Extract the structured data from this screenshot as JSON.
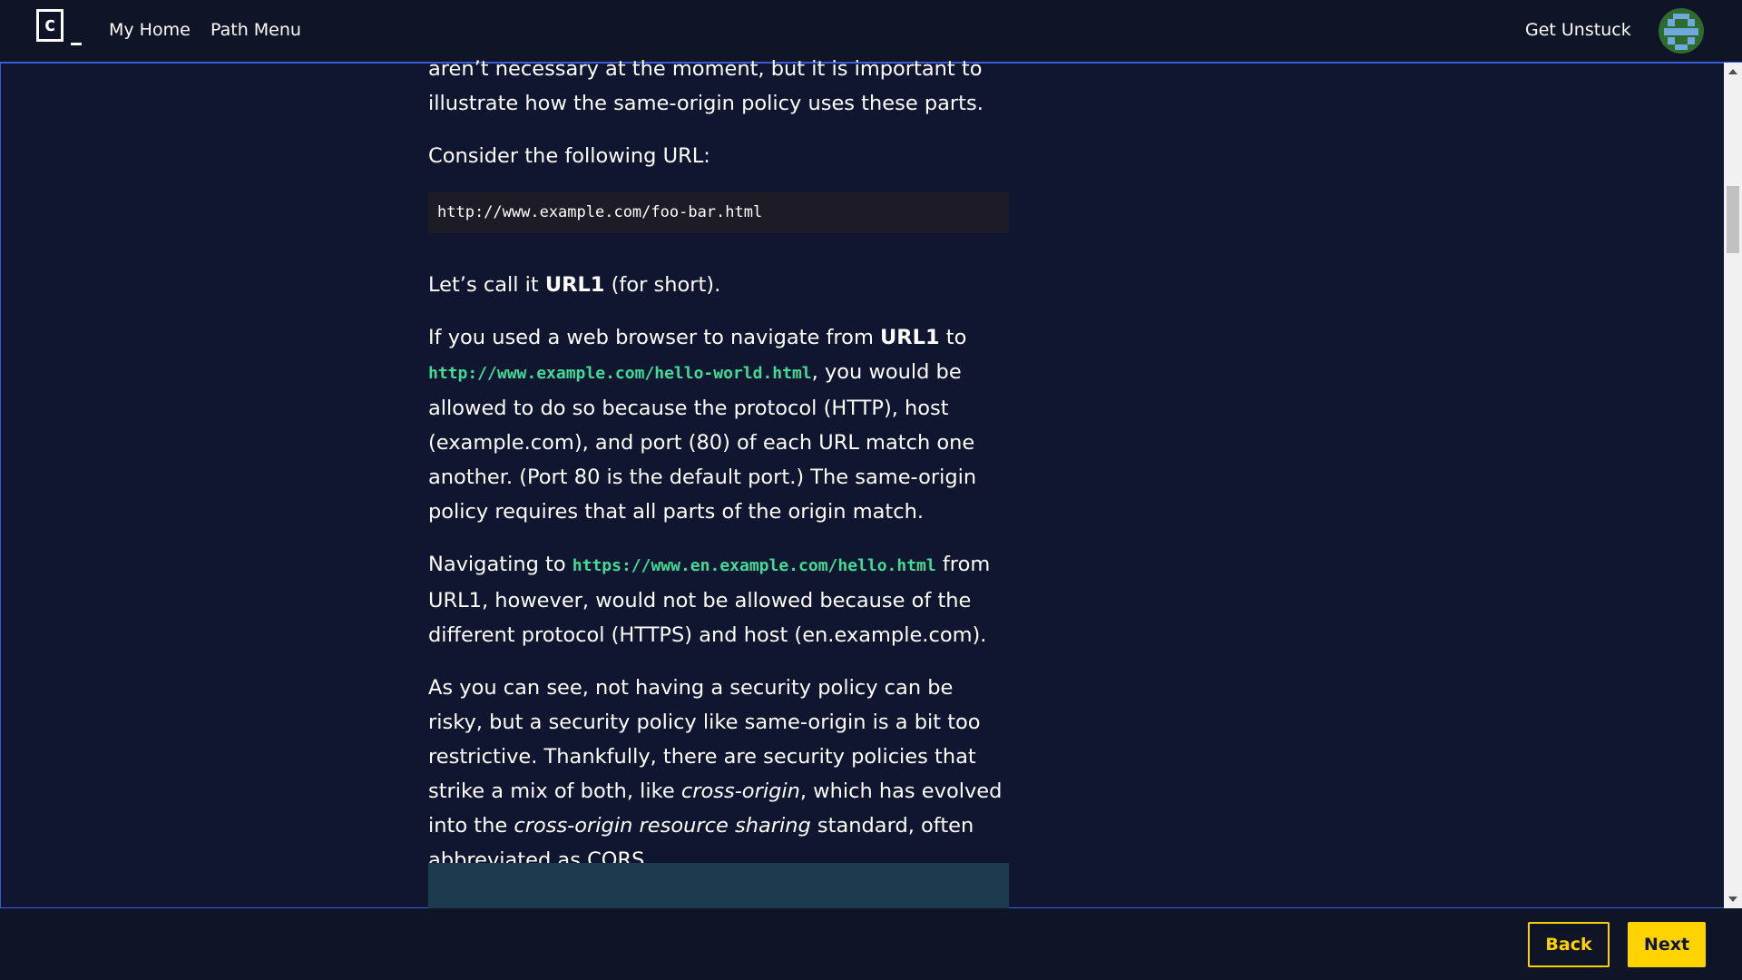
{
  "header": {
    "logo_text": "c",
    "nav": [
      "My Home",
      "Path Menu"
    ],
    "help_label": "Get Unstuck"
  },
  "article": {
    "p0": "aren’t necessary at the moment, but it is important to illustrate how the same-origin policy uses these parts.",
    "p1": "Consider the following URL:",
    "code1": "http://www.example.com/foo-bar.html",
    "p2_a": "Let’s call it ",
    "p2_b": "URL1",
    "p2_c": " (for short).",
    "p3_a": "If you used a web browser to navigate from ",
    "p3_b": "URL1",
    "p3_c": " to ",
    "p3_code": "http://www.example.com/hello-world.html",
    "p3_d": ", you would be allowed to do so because the protocol (HTTP), host (example.com), and port (80) of each URL match one another. (Port 80 is the default port.) The same-origin policy requires that all parts of the origin match.",
    "p4_a": "Navigating to ",
    "p4_code": "https://www.en.example.com/hello.html",
    "p4_b": " from URL1, however, would not be allowed because of the different protocol (HTTPS) and host (en.example.com).",
    "p5_a": "As you can see, not having a security policy can be risky, but a security policy like same-origin is a bit too restrictive. Thankfully, there are security policies that strike a mix of both, like ",
    "p5_em1": "cross-origin",
    "p5_b": ", which has evolved into the ",
    "p5_em2": "cross-origin resource sharing",
    "p5_c": " standard, often abbreviated as CORS."
  },
  "footer": {
    "back_label": "Back",
    "next_label": "Next"
  },
  "colors": {
    "background": "#10162f",
    "accent_yellow": "#ffd300",
    "code_green": "#3ddc97",
    "frame_blue": "#3b5bdb"
  }
}
